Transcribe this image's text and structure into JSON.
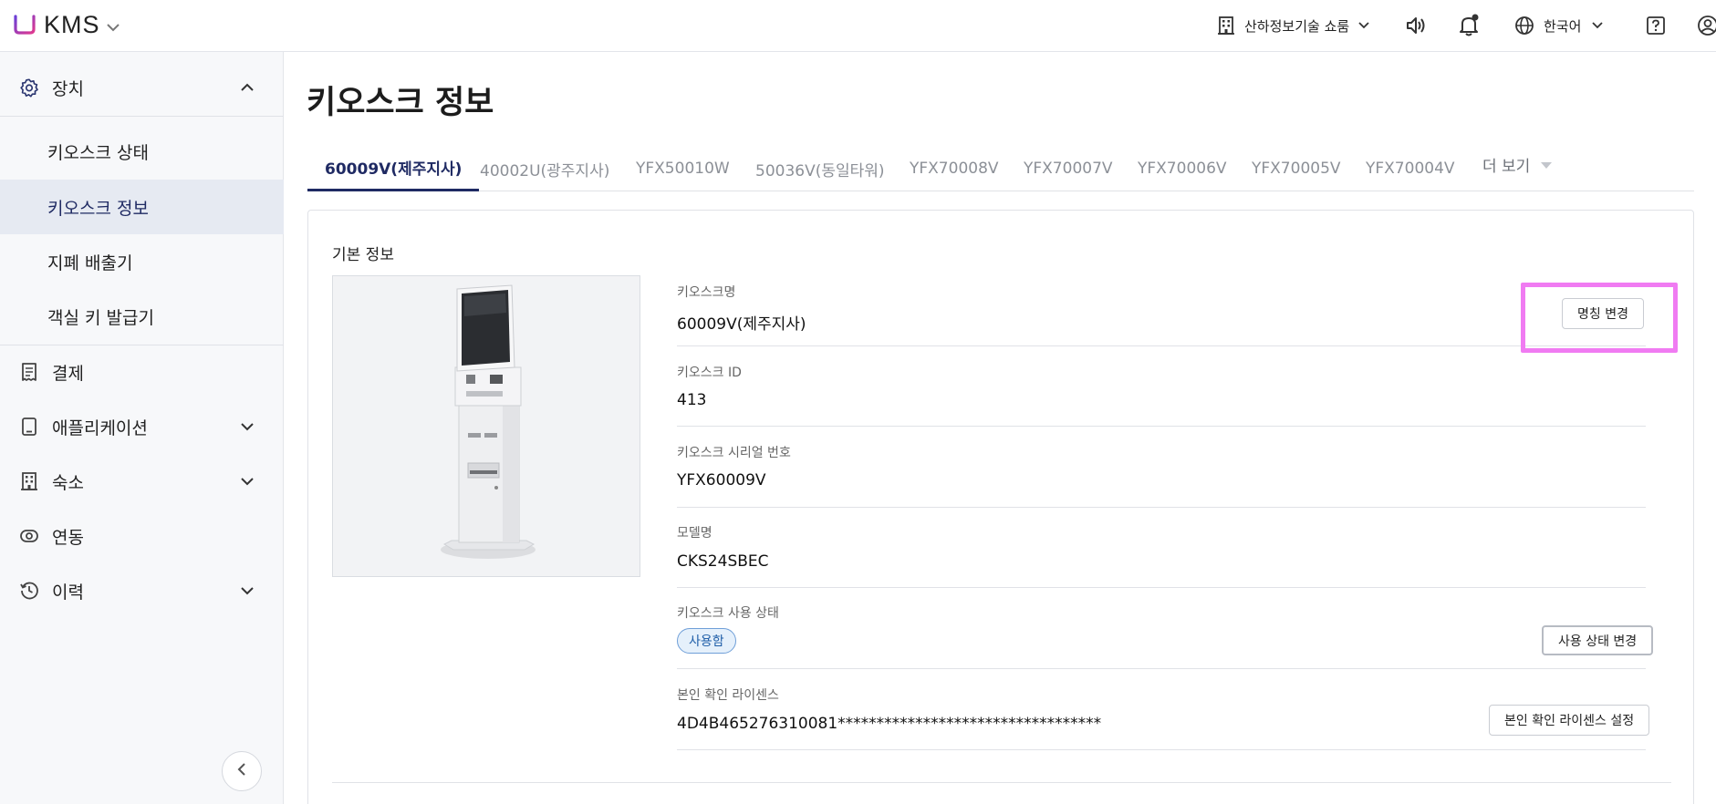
{
  "header": {
    "app_name": "KMS",
    "store_name": "산하정보기술 쇼룸",
    "language": "한국어",
    "icons": {
      "logo": "brand-w-logo",
      "store": "building-icon",
      "sound": "speaker-icon",
      "notification": "bell-icon",
      "language": "globe-icon",
      "help": "help-icon",
      "account": "account-icon"
    }
  },
  "sidebar": {
    "device": {
      "label": "장치",
      "icon": "gear-icon",
      "expanded": true
    },
    "device_items": [
      {
        "label": "키오스크 상태",
        "active": false
      },
      {
        "label": "키오스크 정보",
        "active": true
      },
      {
        "label": "지폐 배출기",
        "active": false
      },
      {
        "label": "객실 키 발급기",
        "active": false
      }
    ],
    "items": [
      {
        "label": "결제",
        "icon": "receipt-icon",
        "expandable": false
      },
      {
        "label": "애플리케이션",
        "icon": "tablet-icon",
        "expandable": true
      },
      {
        "label": "숙소",
        "icon": "building-icon",
        "expandable": true
      },
      {
        "label": "연동",
        "icon": "link-icon",
        "expandable": false
      },
      {
        "label": "이력",
        "icon": "history-icon",
        "expandable": true
      }
    ]
  },
  "main": {
    "title": "키오스크 정보",
    "tabs": [
      {
        "label": "60009V(제주지사)",
        "active": true
      },
      {
        "label": "40002U(광주지사)",
        "active": false
      },
      {
        "label": "YFX50010W",
        "active": false
      },
      {
        "label": "50036V(동일타워)",
        "active": false
      },
      {
        "label": "YFX70008V",
        "active": false
      },
      {
        "label": "YFX70007V",
        "active": false
      },
      {
        "label": "YFX70006V",
        "active": false
      },
      {
        "label": "YFX70005V",
        "active": false
      },
      {
        "label": "YFX70004V",
        "active": false
      }
    ],
    "more_label": "더 보기",
    "section_title": "기본 정보",
    "fields": {
      "kiosk_name": {
        "label": "키오스크명",
        "value": "60009V(제주지사)",
        "button": "명칭 변경"
      },
      "kiosk_id": {
        "label": "키오스크 ID",
        "value": "413"
      },
      "serial": {
        "label": "키오스크 시리얼 번호",
        "value": "YFX60009V"
      },
      "model": {
        "label": "모델명",
        "value": "CKS24SBEC"
      },
      "usage_status": {
        "label": "키오스크 사용 상태",
        "badge": "사용함",
        "button": "사용 상태 변경"
      },
      "license": {
        "label": "본인 확인 라이센스",
        "value": "4D4B465276310081**********************************",
        "button": "본인 확인 라이센스 설정"
      }
    }
  },
  "colors": {
    "accent": "#1f2a63",
    "active_bg": "#e6eaf2",
    "badge_border": "#6f9fd8",
    "badge_bg": "#e5f0fb",
    "highlight": "#f07bf2"
  }
}
